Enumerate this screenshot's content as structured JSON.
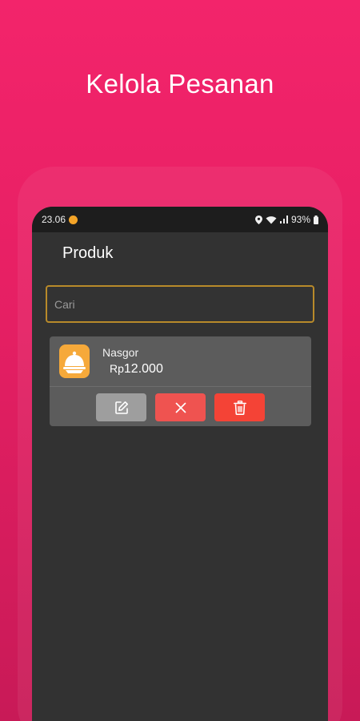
{
  "headline": "Kelola Pesanan",
  "status_bar": {
    "time": "23.06",
    "battery": "93%"
  },
  "appbar": {
    "title": "Produk"
  },
  "search": {
    "placeholder": "Cari",
    "value": ""
  },
  "product": {
    "name": "Nasgor",
    "currency": "Rp",
    "price": "12.000"
  },
  "actions": {
    "edit_icon": "edit-icon",
    "cancel_icon": "close-icon",
    "delete_icon": "trash-icon"
  },
  "colors": {
    "background": "#f3246b",
    "accent": "#b88a2a",
    "product_icon": "#f6a93a",
    "edit_button": "#9e9e9e",
    "cancel_button": "#ef5350",
    "delete_button": "#f44336"
  }
}
